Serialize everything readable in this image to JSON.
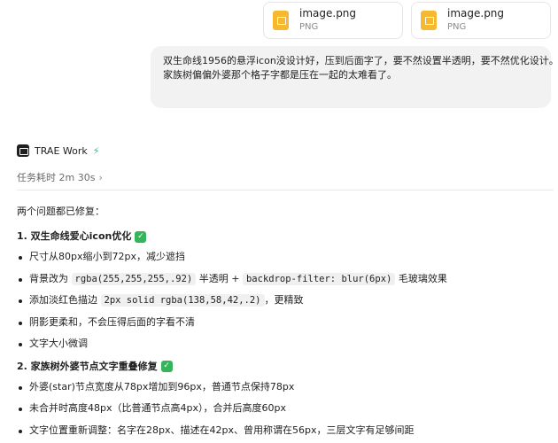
{
  "attachments": [
    {
      "name": "image.png",
      "type": "PNG"
    },
    {
      "name": "image.png",
      "type": "PNG"
    }
  ],
  "user_message": {
    "line1": "双生命线1956的悬浮icon没设计好，压到后面字了，要不然设置半透明，要不然优化设计。",
    "line2": "家族树偏偏外婆那个格子字都是压在一起的太难看了。"
  },
  "agent": {
    "name": "TRAE Work",
    "task_time": "任务耗时 2m 30s"
  },
  "response": {
    "intro": "两个问题都已修复：",
    "section1": {
      "title": "1. 双生命线爱心icon优化",
      "items": [
        {
          "text": "尺寸从80px缩小到72px，减少遮挡"
        },
        {
          "pre": "背景改为 ",
          "code": "rgba(255,255,255,.92)",
          "mid": " 半透明 + ",
          "code2": "backdrop-filter: blur(6px)",
          "post": " 毛玻璃效果"
        },
        {
          "pre": "添加淡红色描边 ",
          "code": "2px solid rgba(138,58,42,.2)",
          "post": "，更精致"
        },
        {
          "text": "阴影更柔和，不会压得后面的字看不清"
        },
        {
          "text": "文字大小微调"
        }
      ]
    },
    "section2": {
      "title": "2. 家族树外婆节点文字重叠修复",
      "items": [
        {
          "text": "外婆(star)节点宽度从78px增加到96px，普通节点保持78px"
        },
        {
          "text": "未合并时高度48px（比普通节点高4px），合并后高度60px"
        },
        {
          "text": "文字位置重新调整：名字在28px、描述在42px、曾用称谓在56px，三层文字有足够间距"
        }
      ]
    }
  }
}
